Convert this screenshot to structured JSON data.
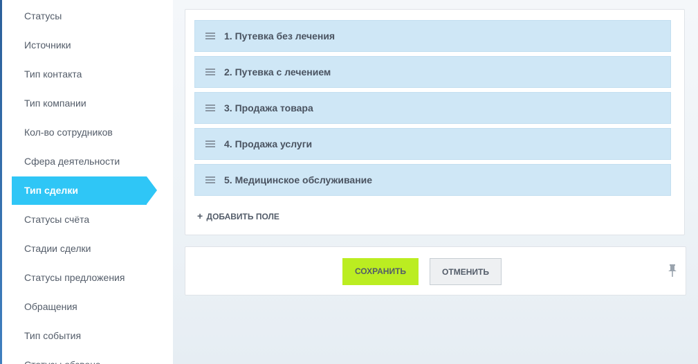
{
  "sidebar": {
    "items": [
      {
        "label": "Статусы"
      },
      {
        "label": "Источники"
      },
      {
        "label": "Тип контакта"
      },
      {
        "label": "Тип компании"
      },
      {
        "label": "Кол-во сотрудников"
      },
      {
        "label": "Сфера деятельности"
      },
      {
        "label": "Тип сделки",
        "active": true
      },
      {
        "label": "Статусы счёта"
      },
      {
        "label": "Стадии сделки"
      },
      {
        "label": "Статусы предложения"
      },
      {
        "label": "Обращения"
      },
      {
        "label": "Тип события"
      },
      {
        "label": "Статусы обзвона"
      }
    ]
  },
  "fields": {
    "items": [
      {
        "label": "1. Путевка без лечения"
      },
      {
        "label": "2. Путевка с лечением"
      },
      {
        "label": "3. Продажа товара"
      },
      {
        "label": "4. Продажа услуги"
      },
      {
        "label": "5. Медицинское обслуживание"
      }
    ],
    "add_label": "ДОБАВИТЬ ПОЛЕ",
    "add_plus": "+"
  },
  "footer": {
    "save_label": "СОХРАНИТЬ",
    "cancel_label": "ОТМЕНИТЬ"
  },
  "icons": {
    "drag": "drag-handle-icon",
    "pin": "pin-icon"
  },
  "colors": {
    "active_item": "#2fc6f6",
    "field_row": "#cfe7f6",
    "save_button": "#bbed21",
    "text": "#535c69"
  }
}
